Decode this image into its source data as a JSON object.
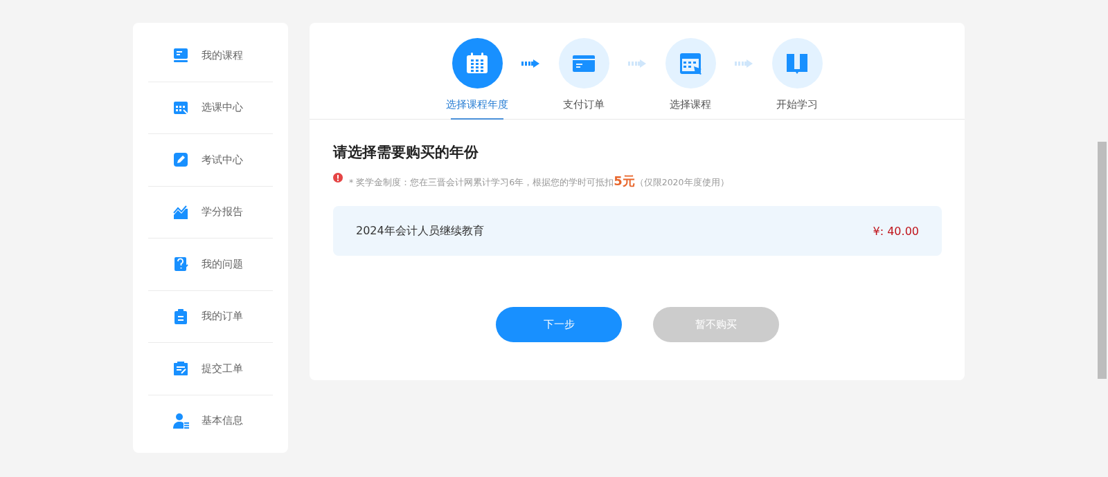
{
  "sidebar": {
    "items": [
      {
        "label": "我的课程"
      },
      {
        "label": "选课中心"
      },
      {
        "label": "考试中心"
      },
      {
        "label": "学分报告"
      },
      {
        "label": "我的问题"
      },
      {
        "label": "我的订单"
      },
      {
        "label": "提交工单"
      },
      {
        "label": "基本信息"
      }
    ]
  },
  "steps": [
    {
      "label": "选择课程年度",
      "selected": true
    },
    {
      "label": "支付订单",
      "selected": false
    },
    {
      "label": "选择课程",
      "selected": false
    },
    {
      "label": "开始学习",
      "selected": false
    }
  ],
  "heading": "请选择需要购买的年份",
  "notice": "* 奖学金制度：您在三晋会计网累计学习6年，根据您的学时可抵扣**5元**（仅限2020年度使用）",
  "course": {
    "name": "2024年会计人员继续教育",
    "price": "¥: 40.00"
  },
  "buttons": [
    {
      "label": "下一步",
      "kind": "primary"
    },
    {
      "label": "暂不购买",
      "kind": "secondary"
    }
  ]
}
